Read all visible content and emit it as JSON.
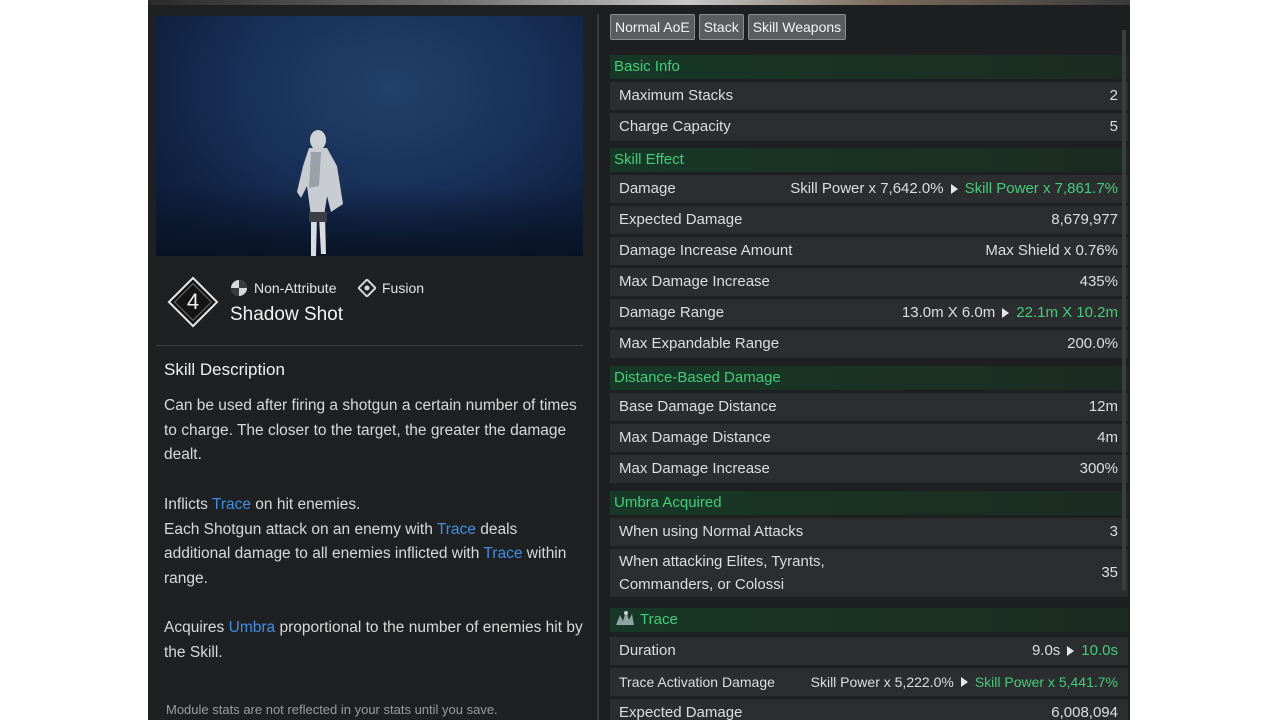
{
  "skill": {
    "number": "4",
    "attribute": "Non-Attribute",
    "type": "Fusion",
    "name": "Shadow Shot"
  },
  "description": {
    "title": "Skill Description",
    "para1": "Can be used after firing a shotgun a certain number of times to charge. The closer to the target, the greater the damage dealt.",
    "para2_line1_pre": "Inflicts ",
    "para2_keyword": "Trace",
    "para2_line1_post": " on hit enemies.",
    "para2_line2_pre": "Each Shotgun attack on an enemy with ",
    "para2_line2_post": " deals additional damage to all enemies inflicted with ",
    "para2_line3_post": " within range.",
    "para3_pre": "Acquires ",
    "para3_keyword": "Umbra",
    "para3_post": " proportional to the number of enemies hit by the Skill.",
    "note": "Module stats are not reflected in your stats until you save."
  },
  "tags": [
    "Normal AoE",
    "Stack",
    "Skill Weapons"
  ],
  "sections": {
    "basic_info": "Basic Info",
    "skill_effect": "Skill Effect",
    "distance_damage": "Distance-Based Damage",
    "umbra": "Umbra Acquired",
    "trace": "Trace"
  },
  "rows": {
    "max_stacks": {
      "label": "Maximum Stacks",
      "value": "2"
    },
    "charge": {
      "label": "Charge Capacity",
      "value": "5"
    },
    "damage": {
      "label": "Damage",
      "value": "Skill Power x 7,642.0%",
      "value_new": "Skill Power x 7,861.7%"
    },
    "expected": {
      "label": "Expected Damage",
      "value": "8,679,977"
    },
    "dmg_inc_amt": {
      "label": "Damage Increase Amount",
      "value": "Max Shield x 0.76%"
    },
    "max_dmg_inc": {
      "label": "Max Damage Increase",
      "value": "435%"
    },
    "dmg_range": {
      "label": "Damage Range",
      "value": "13.0m X 6.0m",
      "value_new": "22.1m X 10.2m"
    },
    "max_exp_range": {
      "label": "Max Expandable Range",
      "value": "200.0%"
    },
    "base_dist": {
      "label": "Base Damage Distance",
      "value": "12m"
    },
    "max_dist": {
      "label": "Max Damage Distance",
      "value": "4m"
    },
    "max_dmg_inc2": {
      "label": "Max Damage Increase",
      "value": "300%"
    },
    "normal_attacks": {
      "label": "When using Normal Attacks",
      "value": "3"
    },
    "elites_line1": "When attacking Elites, Tyrants,",
    "elites_line2": "Commanders, or Colossi",
    "elites_value": "35",
    "duration": {
      "label": "Duration",
      "value": "9.0s",
      "value_new": "10.0s"
    },
    "trace_dmg": {
      "label": "Trace Activation Damage",
      "value": "Skill Power x 5,222.0%",
      "value_new": "Skill Power x 5,441.7%"
    },
    "trace_expected": {
      "label": "Expected Damage",
      "value": "6,008,094"
    }
  },
  "colors": {
    "accent_green": "#3fce7a",
    "keyword_blue": "#3e8ee6",
    "panel": "#1e1f20",
    "row": "#2c2d2f"
  }
}
